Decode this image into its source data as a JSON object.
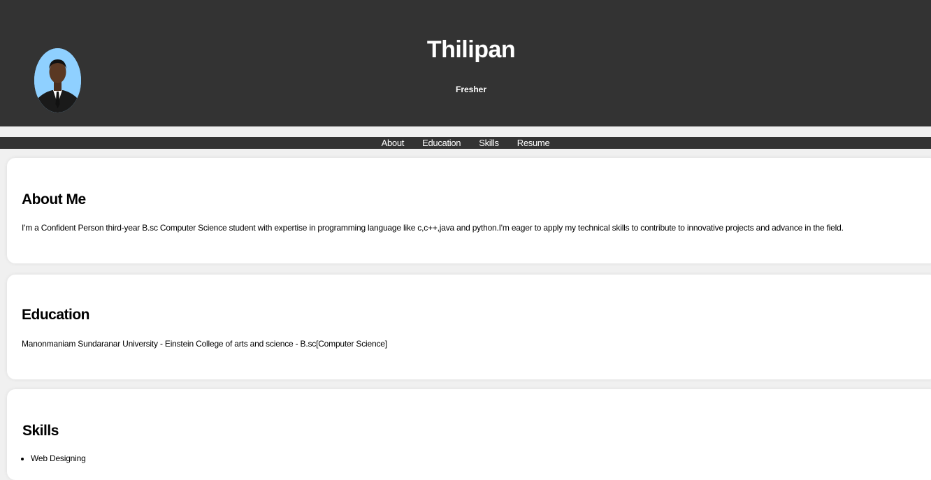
{
  "header": {
    "name": "Thilipan",
    "subtitle": "Fresher",
    "avatar_icon": "profile-photo"
  },
  "nav": {
    "items": [
      {
        "label": "About"
      },
      {
        "label": "Education"
      },
      {
        "label": "Skills"
      },
      {
        "label": "Resume"
      }
    ]
  },
  "about": {
    "title": "About Me",
    "text": "I'm a Confident Person third-year B.sc Computer Science student with expertise in programming language like c,c++,java and python.I'm eager to apply my technical skills to contribute to innovative projects and advance in the field."
  },
  "education": {
    "title": "Education",
    "text": "Manonmaniam Sundaranar University - Einstein College of arts and science - B.sc[Computer Science]"
  },
  "skills": {
    "title": "Skills",
    "items": [
      "Web Designing"
    ]
  },
  "colors": {
    "header_bg": "#333333",
    "page_bg": "#f0f0f0",
    "card_bg": "#ffffff",
    "text": "#000000",
    "header_text": "#ffffff"
  }
}
